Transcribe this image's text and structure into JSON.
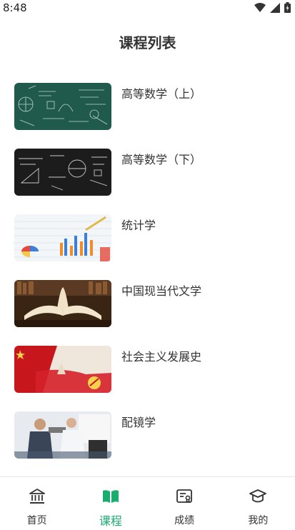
{
  "status": {
    "time": "8:48"
  },
  "page": {
    "title": "课程列表"
  },
  "courses": [
    {
      "name": "高等数学（上）"
    },
    {
      "name": "高等数学（下）"
    },
    {
      "name": "统计学"
    },
    {
      "name": "中国现当代文学"
    },
    {
      "name": "社会主义发展史"
    },
    {
      "name": "配镜学"
    }
  ],
  "tabs": [
    {
      "label": "首页",
      "icon": "home-bank-icon"
    },
    {
      "label": "课程",
      "icon": "book-icon"
    },
    {
      "label": "成绩",
      "icon": "grade-card-icon"
    },
    {
      "label": "我的",
      "icon": "graduation-cap-icon"
    }
  ],
  "active_tab": "课程",
  "colors": {
    "accent": "#1aad6e",
    "text": "#333333"
  }
}
